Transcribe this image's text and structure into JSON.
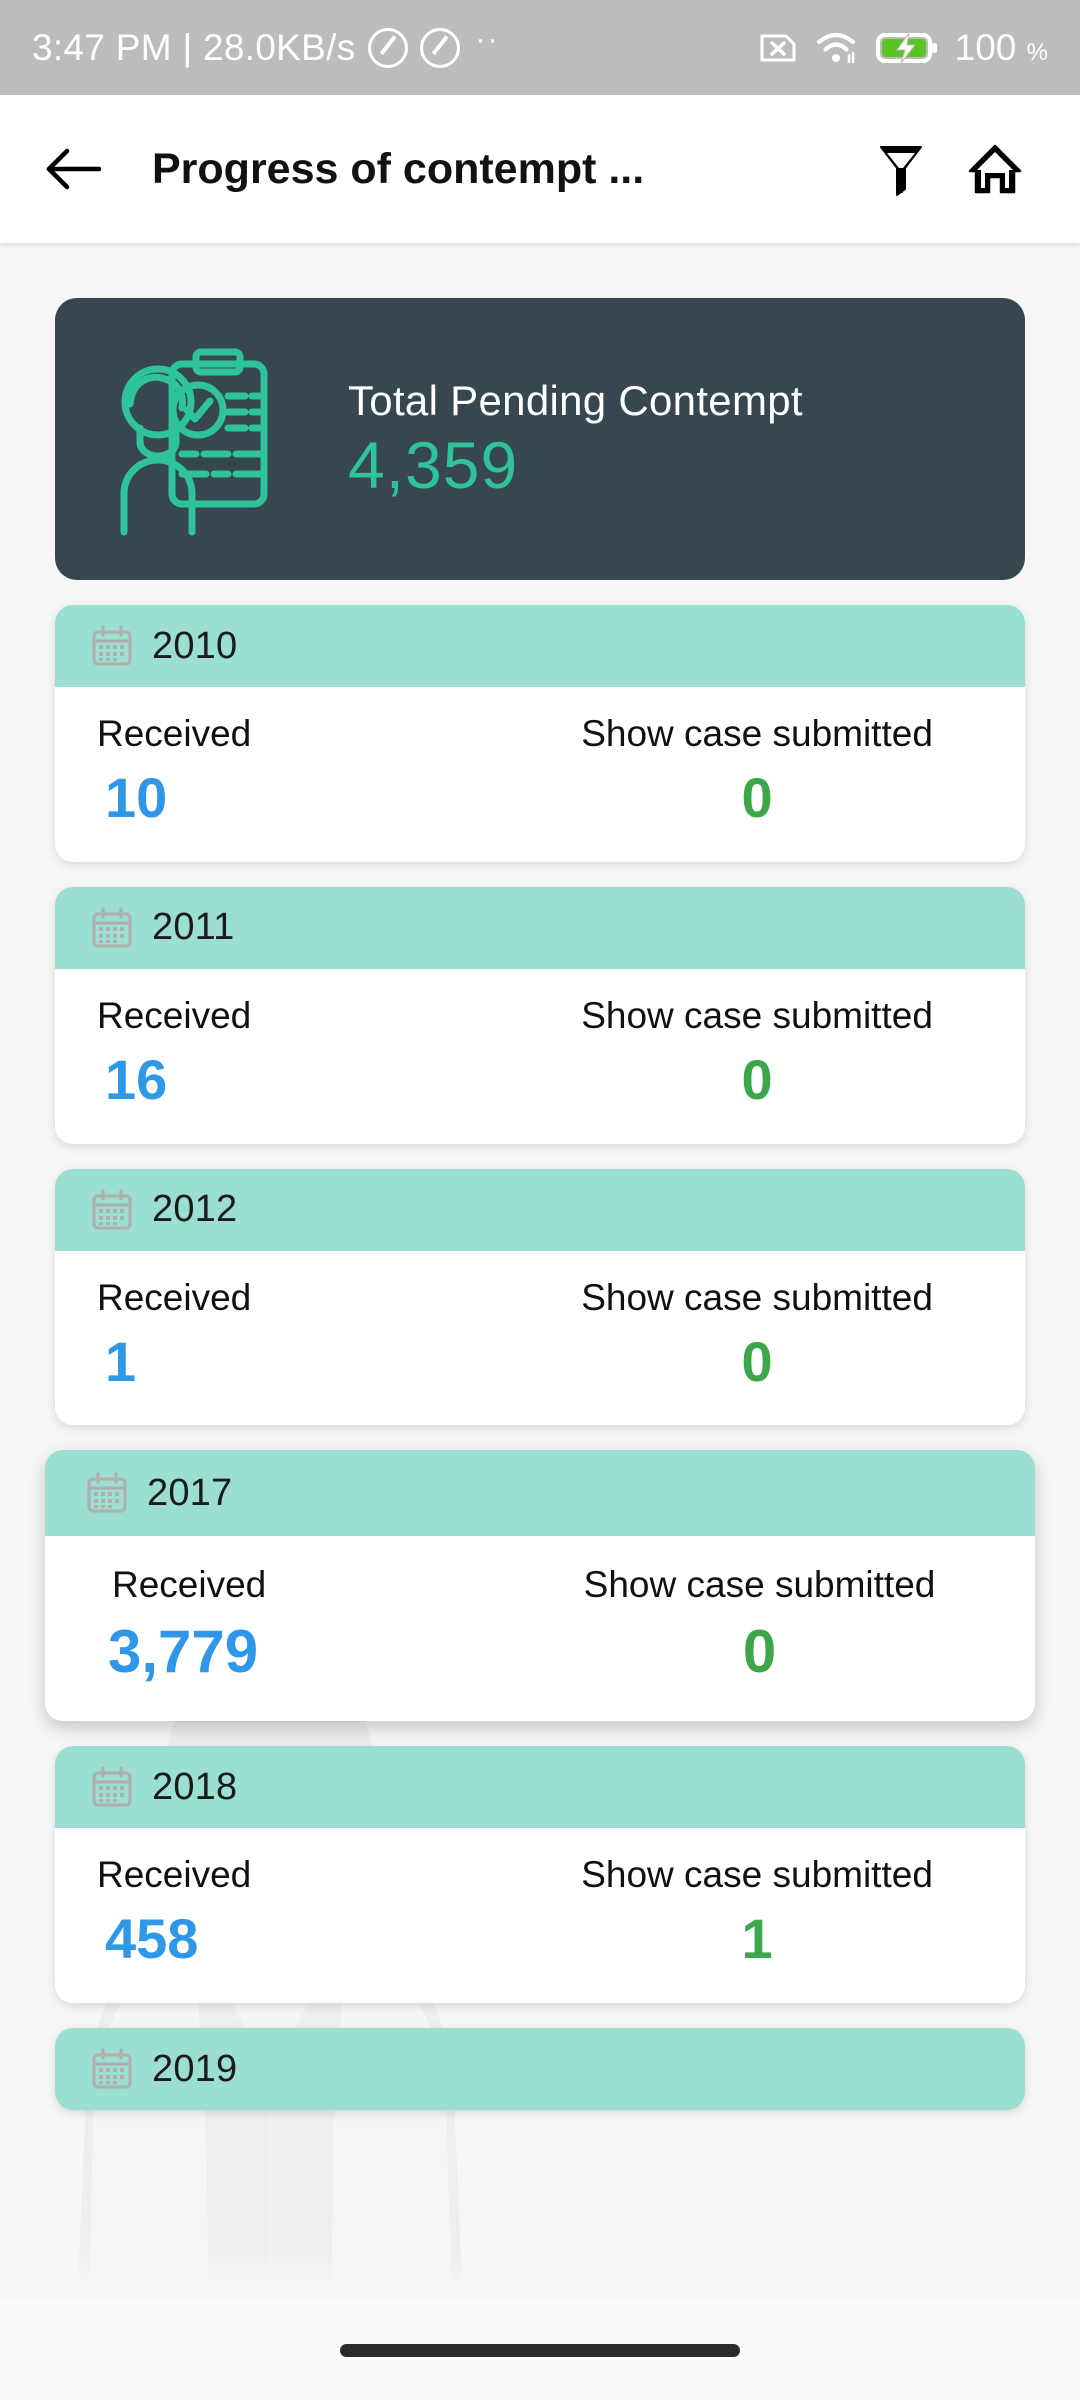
{
  "status_bar": {
    "clock": "3:47 PM | 28.0KB/s",
    "icons": [
      "do-not-disturb-icon",
      "do-not-disturb-icon",
      "more-dots-icon"
    ],
    "right_icons": [
      "no-sim-icon",
      "wifi-icon",
      "battery-charging-icon"
    ],
    "battery_percent": "100",
    "battery_unit": "%"
  },
  "app_bar": {
    "back_icon": "arrow-left-icon",
    "title": "Progress of contempt ...",
    "filter_icon": "funnel-filter-icon",
    "home_icon": "home-icon"
  },
  "summary": {
    "icon": "person-clipboard-checklist-icon",
    "label": "Total Pending Contempt",
    "value": "4,359"
  },
  "labels": {
    "received": "Received",
    "show_case_submitted": "Show case submitted",
    "calendar_icon": "calendar-icon"
  },
  "colors": {
    "dark_card": "#36474f",
    "teal_accent": "#2fc39a",
    "card_header_teal": "#9bdfd2",
    "received_blue": "#2e97e8",
    "submitted_green": "#3da54a",
    "page_background": "#f7f7f7",
    "status_bar": "#bcbcbc"
  },
  "year_cards": [
    {
      "year": "2010",
      "received": "10",
      "show_case_submitted": "0",
      "raised": false
    },
    {
      "year": "2011",
      "received": "16",
      "show_case_submitted": "0",
      "raised": false
    },
    {
      "year": "2012",
      "received": "1",
      "show_case_submitted": "0",
      "raised": false
    },
    {
      "year": "2017",
      "received": "3,779",
      "show_case_submitted": "0",
      "raised": true
    },
    {
      "year": "2018",
      "received": "458",
      "show_case_submitted": "1",
      "raised": false
    },
    {
      "year": "2019",
      "received": "",
      "show_case_submitted": "",
      "raised": false
    }
  ]
}
